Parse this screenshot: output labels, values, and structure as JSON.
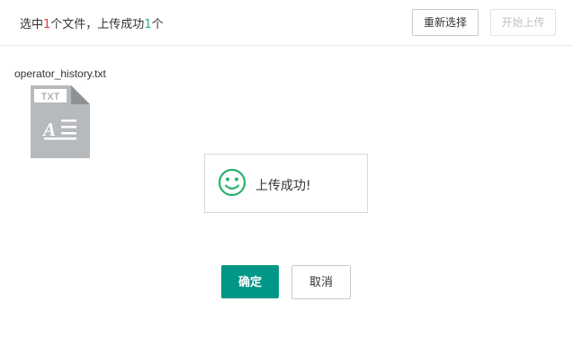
{
  "header": {
    "status_prefix": "选中",
    "selected_count": "1",
    "status_middle": "个文件，上传成功",
    "success_count": "1",
    "status_suffix": "个",
    "reselect_label": "重新选择",
    "start_upload_label": "开始上传"
  },
  "file": {
    "name": "operator_history.txt",
    "type_badge": "TXT",
    "icon": "text-file-icon"
  },
  "toast": {
    "icon": "smiley-icon",
    "message": "上传成功!"
  },
  "actions": {
    "confirm_label": "确定",
    "cancel_label": "取消"
  },
  "colors": {
    "primary": "#009688",
    "success_icon": "#2ab06f",
    "count_red": "#e4393c",
    "file_icon_gray": "#b7babc"
  }
}
